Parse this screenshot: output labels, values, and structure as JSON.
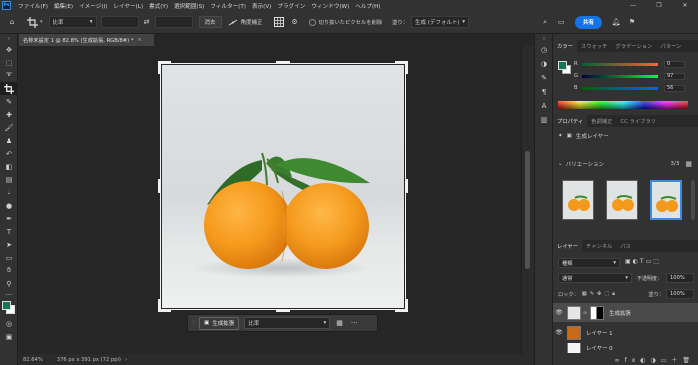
{
  "app": {
    "logo": "Ps"
  },
  "menu": [
    "ファイル(F)",
    "編集(E)",
    "イメージ(I)",
    "レイヤー(L)",
    "書式(Y)",
    "選択範囲(S)",
    "フィルター(T)",
    "表示(V)",
    "プラグイン",
    "ウィンドウ(W)",
    "ヘルプ(H)"
  ],
  "window_controls": [
    "—",
    "❐",
    "✕"
  ],
  "options_bar": {
    "ratio_select": "比率",
    "clear_label": "消去",
    "straighten_label": "角度補正",
    "delete_cropped_label": "切り抜いたピクセルを削除",
    "fill_label": "塗り：",
    "fill_select": "生成 (デフォルト)",
    "share_label": "共有"
  },
  "document": {
    "tab_title": "名称未設定 1 @ 82.8% (生成拡張, RGB/8#) *",
    "tab_close": "×"
  },
  "status": {
    "zoom": "82.64%",
    "dimensions": "376 px x 391 px (72 ppi)"
  },
  "context_bar": {
    "generate_label": "生成拡張",
    "ratio_select": "比率",
    "more": "···"
  },
  "color_panel": {
    "tabs": [
      "カラー",
      "スウォッチ",
      "グラデーション",
      "パターン"
    ],
    "fg_color": "#0f7a55",
    "sliders": [
      {
        "label": "R",
        "value": "0"
      },
      {
        "label": "G",
        "value": "97"
      },
      {
        "label": "B",
        "value": "56"
      }
    ]
  },
  "properties_panel": {
    "tabs": [
      "プロパティ",
      "色調補正",
      "CC ライブラリ"
    ],
    "layer_type": "生成レイヤー",
    "variations_label": "バリエーション",
    "variations_count": "3/3",
    "selected_variation": 3
  },
  "layers_panel": {
    "tabs": [
      "レイヤー",
      "チャンネル",
      "パス"
    ],
    "kind_select": "種類",
    "blend_select": "通常",
    "opacity_label": "不透明度：",
    "opacity_value": "100%",
    "lock_label": "ロック：",
    "fill_label": "塗り：",
    "fill_value": "100%",
    "layers": [
      {
        "name": "生成拡張",
        "selected": true
      },
      {
        "name": "レイヤー 1",
        "selected": false
      },
      {
        "name": "レイヤー 0",
        "selected": false
      }
    ]
  }
}
